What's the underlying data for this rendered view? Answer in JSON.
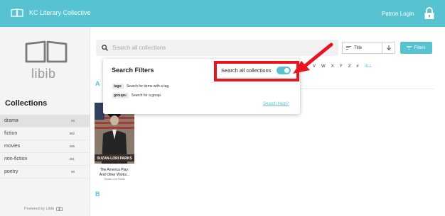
{
  "header": {
    "app_title": "KC Literary Collective",
    "patron_login": "Patron Login",
    "accent_color": "#58c3d0"
  },
  "sidebar": {
    "logo_text": "libib",
    "collections_heading": "Collections",
    "collections": [
      {
        "name": "drama",
        "count": "26",
        "active": true
      },
      {
        "name": "fiction",
        "count": "982",
        "active": false
      },
      {
        "name": "movies",
        "count": "256",
        "active": false
      },
      {
        "name": "non-fiction",
        "count": "451",
        "active": false
      },
      {
        "name": "poetry",
        "count": "68",
        "active": false
      }
    ],
    "powered_by": "Powered by Libib"
  },
  "search": {
    "placeholder": "Search all collections",
    "icon": "search-icon"
  },
  "sort": {
    "label": "Title",
    "icon": "sort-lines-icon"
  },
  "filters_button": {
    "label": "Filters",
    "icon": "filter-icon"
  },
  "alphabet": {
    "letters": [
      "Y",
      "V",
      "W",
      "X",
      "Y",
      "Z",
      "#"
    ],
    "all_label": "ALL"
  },
  "sections": {
    "a": "A",
    "b": "B"
  },
  "book": {
    "title_line1": "The America Play:",
    "title_line2": "And Other Works...",
    "author": "Suzan-Lori Parks",
    "cover_banner": "SUZAN-LORI PARKS"
  },
  "search_filters_popup": {
    "title": "Search Filters",
    "toggle_label": "Search all collections",
    "toggle_on": true,
    "hints": [
      {
        "tag": "tags:",
        "text": "Search for items with a tag."
      },
      {
        "tag": "groups:",
        "text": "Search for a group."
      }
    ],
    "help_link": "Search Help?"
  },
  "annotation": {
    "color": "#e8141f"
  }
}
